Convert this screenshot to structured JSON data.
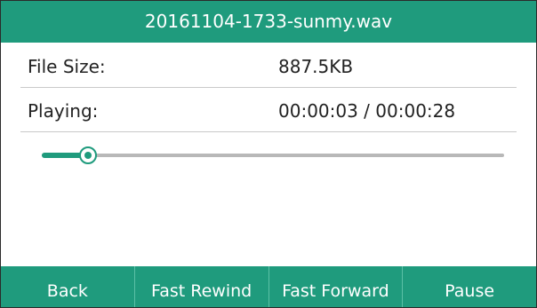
{
  "title": "20161104-1733-sunmy.wav",
  "file_size": {
    "label": "File Size:",
    "value": "887.5KB"
  },
  "playing": {
    "label": "Playing:",
    "value": "00:00:03 / 00:00:28"
  },
  "progress": {
    "fraction": 0.1
  },
  "softkeys": [
    {
      "label": "Back"
    },
    {
      "label": "Fast Rewind"
    },
    {
      "label": "Fast Forward"
    },
    {
      "label": "Pause"
    }
  ],
  "colors": {
    "accent": "#1f9b7d",
    "track": "#b8b8b8"
  }
}
